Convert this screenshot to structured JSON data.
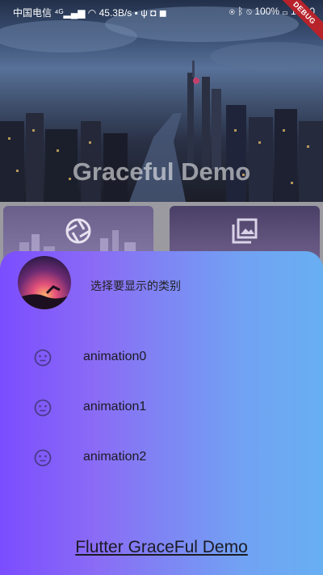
{
  "status_bar": {
    "carrier": "中国电信",
    "speed": "45.3B/s",
    "battery": "100%",
    "time": "10:00",
    "debug_badge": "DEBUG"
  },
  "header": {
    "title": "Graceful Demo"
  },
  "cards": [
    {
      "icon": "aperture-icon"
    },
    {
      "icon": "photo-library-icon"
    }
  ],
  "drawer": {
    "prompt": "选择要显示的类别",
    "items": [
      {
        "label": "animation0",
        "icon": "sentiment-neutral-icon"
      },
      {
        "label": "animation1",
        "icon": "sentiment-neutral-icon"
      },
      {
        "label": "animation2",
        "icon": "sentiment-neutral-icon"
      }
    ],
    "footer_link": "Flutter GraceFul Demo"
  },
  "colors": {
    "drawer_gradient_start": "#7b4dff",
    "drawer_gradient_end": "#68aff2",
    "debug_badge": "#b8232b"
  }
}
